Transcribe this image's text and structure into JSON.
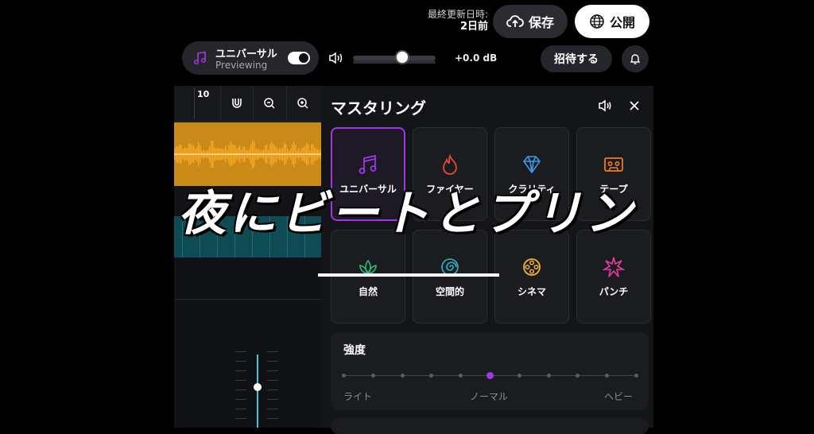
{
  "header": {
    "last_updated_label": "最終更新日時:",
    "last_updated_value": "2日前",
    "save_label": "保存",
    "publish_label": "公開"
  },
  "preset": {
    "name": "ユニバーサル",
    "status": "Previewing",
    "toggle_on": true
  },
  "volume": {
    "level": 0.6,
    "db_readout": "+0.0 dB"
  },
  "actions": {
    "invite_label": "招待する"
  },
  "editor": {
    "ruler_number": "10"
  },
  "mastering": {
    "title": "マスタリング",
    "presets": [
      {
        "label": "ユニバーサル",
        "icon": "music-note-icon",
        "color": "#a335e8",
        "selected": true
      },
      {
        "label": "ファイヤー",
        "icon": "fire-icon",
        "color": "#e84a3c",
        "selected": false
      },
      {
        "label": "クラリティ",
        "icon": "diamond-icon",
        "color": "#3b9be8",
        "selected": false
      },
      {
        "label": "テープ",
        "icon": "cassette-icon",
        "color": "#f07a2a",
        "selected": false
      },
      {
        "label": "自然",
        "icon": "lotus-icon",
        "color": "#2cc07a",
        "selected": false
      },
      {
        "label": "空間的",
        "icon": "spiral-icon",
        "color": "#27b9c9",
        "selected": false
      },
      {
        "label": "シネマ",
        "icon": "film-reel-icon",
        "color": "#f0b52a",
        "selected": false
      },
      {
        "label": "パンチ",
        "icon": "burst-icon",
        "color": "#e83aa3",
        "selected": false
      }
    ],
    "strength": {
      "title": "強度",
      "min_label": "ライト",
      "mid_label": "ノーマル",
      "max_label": "ヘビー",
      "value_step": 5,
      "steps": 11
    }
  },
  "overlay": {
    "title": "夜にビートとプリン"
  },
  "colors": {
    "accent": "#a335e8",
    "waveform": "#f5a623",
    "track_teal": "#0f4b52"
  }
}
